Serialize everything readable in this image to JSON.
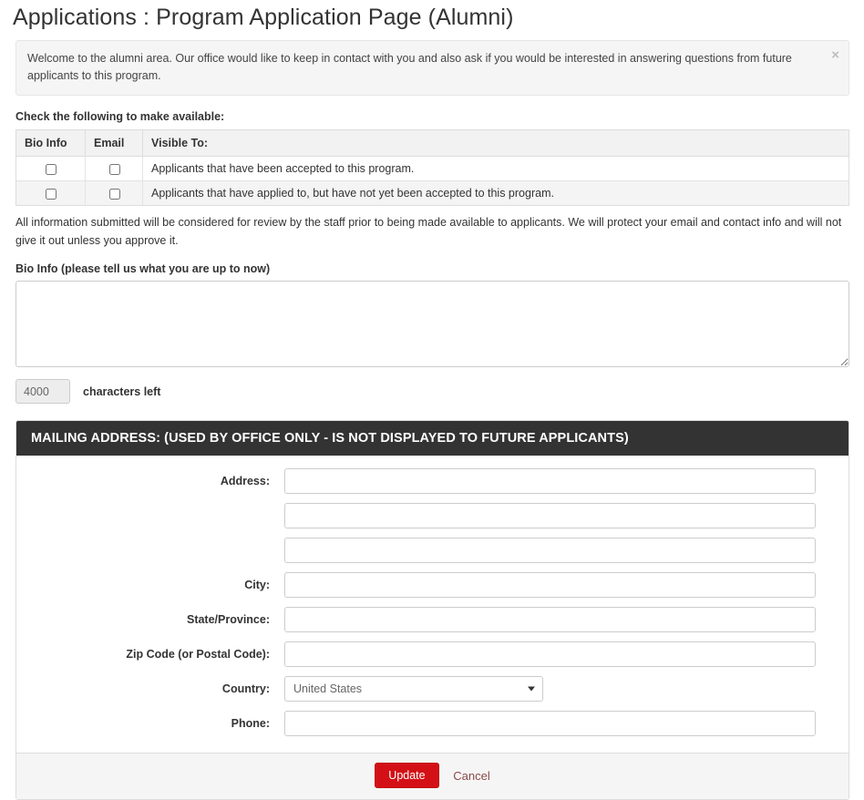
{
  "page": {
    "title": "Applications : Program Application Page (Alumni)"
  },
  "alert": {
    "message": "Welcome to the alumni area. Our office would like to keep in contact with you and also ask if you would be interested in answering questions from future applicants to this program.",
    "close_label": "×"
  },
  "availability": {
    "section_label": "Check the following to make available:",
    "columns": [
      "Bio Info",
      "Email",
      "Visible To:"
    ],
    "rows": [
      {
        "bio_info_checked": false,
        "email_checked": false,
        "visible_to": "Applicants that have been accepted to this program."
      },
      {
        "bio_info_checked": false,
        "email_checked": false,
        "visible_to": "Applicants that have applied to, but have not yet been accepted to this program."
      }
    ]
  },
  "info_paragraph": "All information submitted will be considered for review by the staff prior to being made available to applicants. We will protect your email and contact info and will not give it out unless you approve it.",
  "bio": {
    "label": "Bio Info (please tell us what you are up to now)",
    "value": "",
    "placeholder": "",
    "characters_left_value": "4000",
    "characters_left_label": "characters left"
  },
  "mailing_address": {
    "heading": "MAILING ADDRESS: (USED BY OFFICE ONLY - IS NOT DISPLAYED TO FUTURE APPLICANTS)",
    "fields": [
      {
        "label": "Address:",
        "value": "",
        "placeholder": ""
      },
      {
        "label": "",
        "value": "",
        "placeholder": ""
      },
      {
        "label": "",
        "value": "",
        "placeholder": ""
      },
      {
        "label": "City:",
        "value": "",
        "placeholder": ""
      },
      {
        "label": "State/Province:",
        "value": "",
        "placeholder": ""
      },
      {
        "label": "Zip Code (or Postal Code):",
        "value": "",
        "placeholder": ""
      }
    ],
    "country": {
      "label": "Country:",
      "selected": "United States",
      "options": [
        "United States"
      ]
    },
    "phone": {
      "label": "Phone:",
      "value": "",
      "placeholder": ""
    }
  },
  "actions": {
    "update_label": "Update",
    "cancel_label": "Cancel"
  },
  "colors": {
    "accent_red": "#d31016",
    "panel_header": "#333333",
    "alert_bg": "#f5f5f5",
    "footer_bg": "#f5f5f5"
  }
}
